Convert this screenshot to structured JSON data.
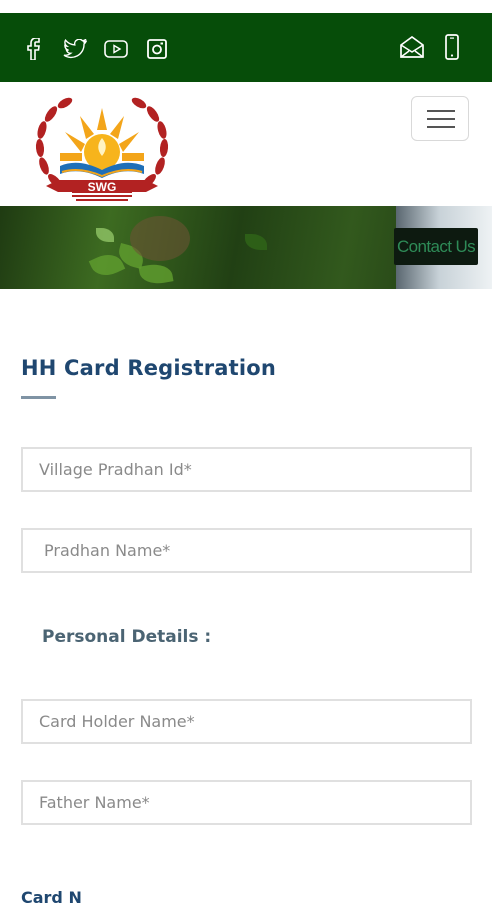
{
  "topbar": {
    "social_icons": [
      "facebook-icon",
      "twitter-icon",
      "youtube-icon",
      "instagram-icon"
    ],
    "contact_icons": [
      "email-icon",
      "phone-icon"
    ],
    "color": "#064d09"
  },
  "header": {
    "logo_text": "SWG",
    "menu_icon": "hamburger-menu-icon"
  },
  "banner": {
    "contact_label": "Contact Us"
  },
  "form": {
    "title": "HH Card Registration",
    "fields": {
      "village_pradhan_id": {
        "placeholder": "Village Pradhan Id*",
        "value": ""
      },
      "pradhan_name": {
        "placeholder": "Pradhan Name*",
        "value": ""
      },
      "card_holder_name": {
        "placeholder": "Card Holder Name*",
        "value": ""
      },
      "father_name": {
        "placeholder": "Father Name*",
        "value": ""
      }
    },
    "personal_heading": "Personal Details :",
    "cutoff_label": "Card N"
  },
  "colors": {
    "title": "#1f4770",
    "section_heading": "#4b6473",
    "topbar": "#064d09"
  }
}
